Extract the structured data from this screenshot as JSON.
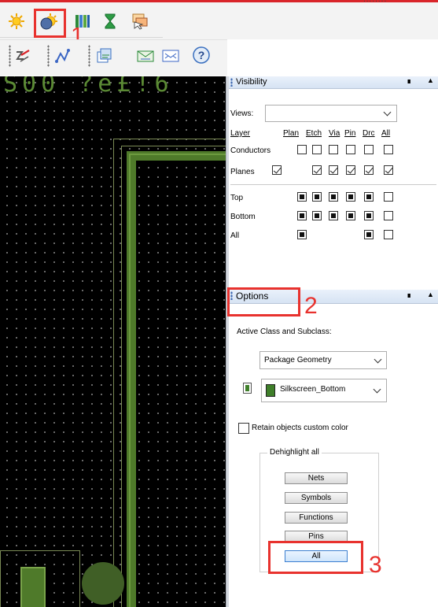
{
  "top_fragment": "........",
  "toolbar": {
    "row1_icons": [
      "sun-icon",
      "shadow-sun-icon",
      "color-columns-icon",
      "hourglass-icon",
      "layer-stack-icon"
    ],
    "row2_icons": [
      "route-icon",
      "connect-lines-icon",
      "copy-layers-icon",
      "envelope-icon",
      "mail-icon",
      "help-icon"
    ]
  },
  "canvas": {
    "top_text": "S00 ?e£!6"
  },
  "visibility": {
    "title": "Visibility",
    "views_label": "Views:",
    "headers": {
      "layer": "Layer",
      "plan": "Plan",
      "etch": "Etch",
      "via": "Via",
      "pin": "Pin",
      "drc": "Drc",
      "all": "All"
    },
    "rows": [
      {
        "label": "Conductors"
      },
      {
        "label": "Planes"
      },
      {
        "label": "Top"
      },
      {
        "label": "Bottom"
      },
      {
        "label": "All"
      }
    ]
  },
  "options": {
    "title": "Options",
    "active_class_label": "Active Class and Subclass:",
    "class_value": "Package Geometry",
    "subclass_value": "Silkscreen_Bottom",
    "retain_label": "Retain objects custom color",
    "dehighlight_label": "Dehighlight all",
    "buttons": [
      "Nets",
      "Symbols",
      "Functions",
      "Pins",
      "All"
    ],
    "accent_color": "#e8322e"
  },
  "annotations": [
    "1",
    "2",
    "3"
  ]
}
